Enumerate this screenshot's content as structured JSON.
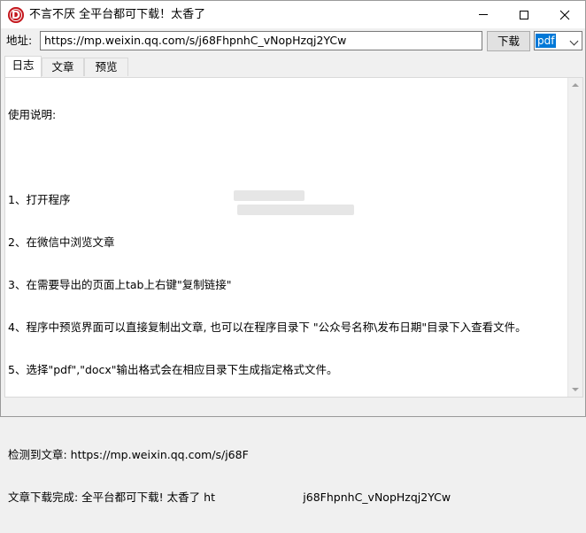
{
  "window": {
    "title": "不言不厌  全平台都可下载！太香了",
    "app_icon_letter": "D"
  },
  "address": {
    "label": "地址:",
    "value": "https://mp.weixin.qq.com/s/j68FhpnhC_vNopHzqj2YCw",
    "download_label": "下载",
    "format_selected": "pdf"
  },
  "tabs": [
    {
      "label": "日志",
      "active": true
    },
    {
      "label": "文章",
      "active": false
    },
    {
      "label": "预览",
      "active": false
    }
  ],
  "log": {
    "lines": [
      "使用说明:",
      "",
      "1、打开程序",
      "2、在微信中浏览文章",
      "3、在需要导出的页面上tab上右键\"复制链接\"",
      "4、程序中预览界面可以直接复制出文章, 也可以在程序目录下 \"公众号名称\\发布日期\"目录下入查看文件。",
      "5、选择\"pdf\",\"docx\"输出格式会在相应目录下生成指定格式文件。",
      "",
      "检测到文章: https://mp.weixin.qq.com/s/j68F",
      "文章下载完成: 全平台都可下载! 太香了 ht                         j68FhpnhC_vNopHzqj2YCw"
    ]
  }
}
